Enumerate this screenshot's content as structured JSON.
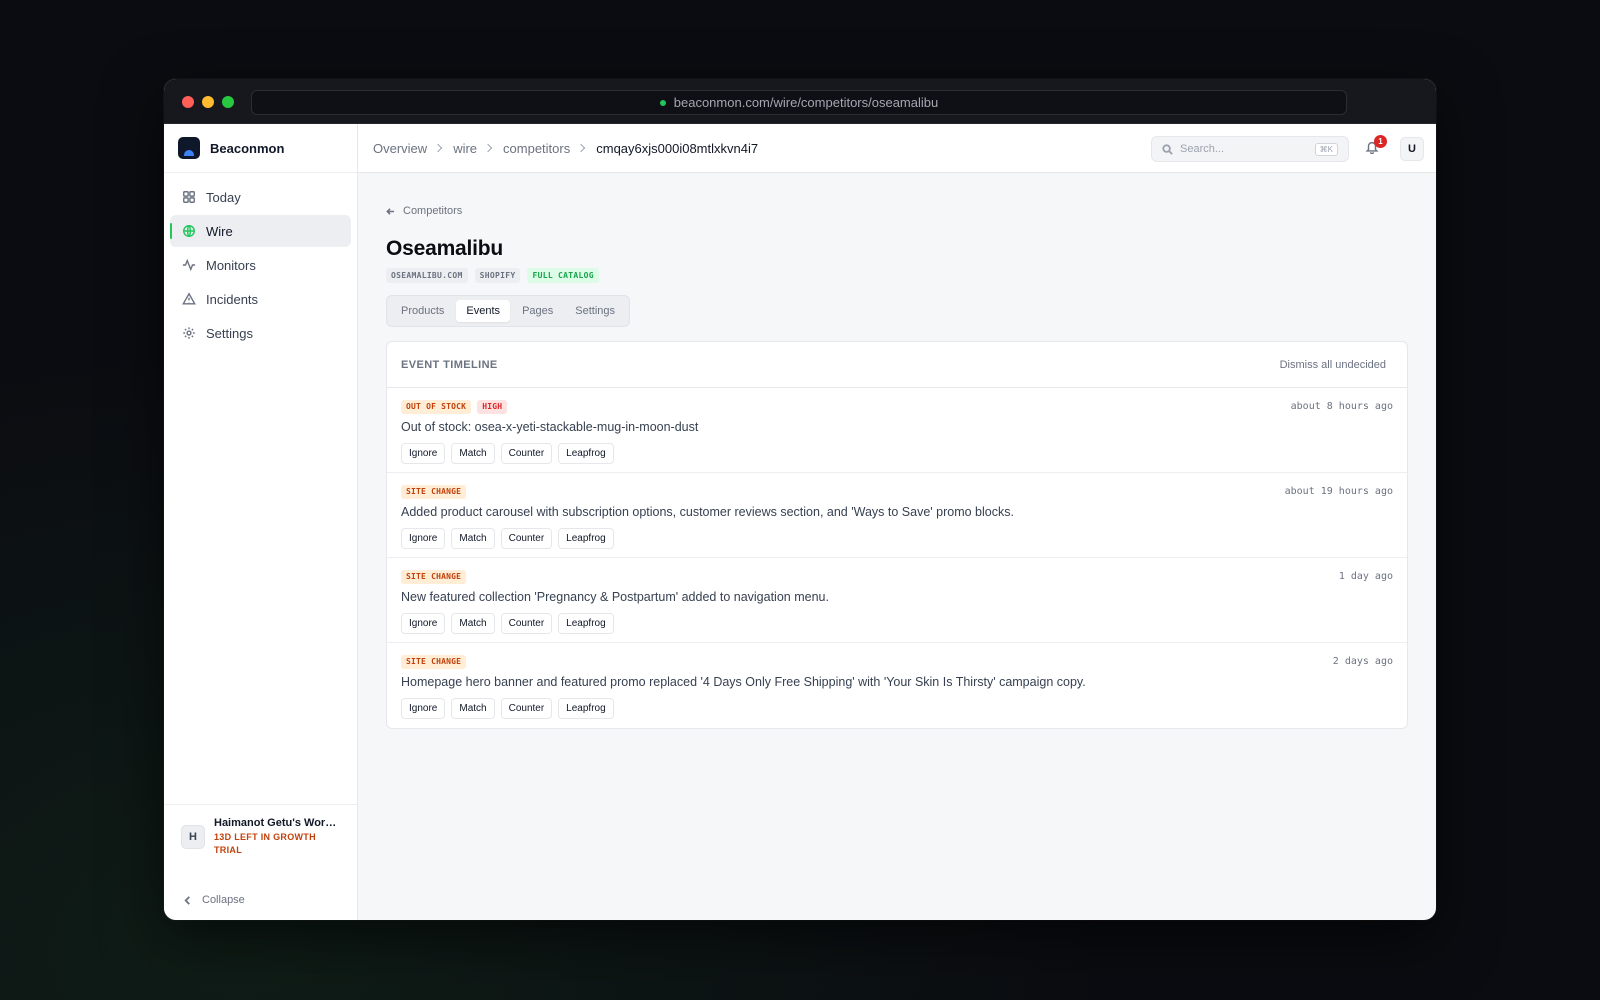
{
  "browser": {
    "url": "beaconmon.com/wire/competitors/oseamalibu"
  },
  "brand": {
    "name": "Beaconmon"
  },
  "sidebar": {
    "items": [
      {
        "label": "Today",
        "icon": "grid-icon"
      },
      {
        "label": "Wire",
        "icon": "globe-icon",
        "active": true
      },
      {
        "label": "Monitors",
        "icon": "activity-icon"
      },
      {
        "label": "Incidents",
        "icon": "alert-triangle-icon"
      },
      {
        "label": "Settings",
        "icon": "gear-icon"
      }
    ],
    "workspace": {
      "initial": "H",
      "name": "Haimanot Getu's Work...",
      "trial": "13D LEFT IN GROWTH TRIAL"
    },
    "collapse_label": "Collapse"
  },
  "header": {
    "breadcrumbs": [
      "Overview",
      "wire",
      "competitors",
      "cmqay6xjs000i08mtlxkvn4i7"
    ],
    "search_placeholder": "Search...",
    "search_shortcut": "⌘K",
    "notification_count": "1",
    "user_initial": "U"
  },
  "page": {
    "back_label": "Competitors",
    "title": "Oseamalibu",
    "tags": [
      {
        "label": "OSEAMALIBU.COM",
        "style": "gray"
      },
      {
        "label": "SHOPIFY",
        "style": "gray"
      },
      {
        "label": "FULL CATALOG",
        "style": "green"
      }
    ],
    "tabs": [
      "Products",
      "Events",
      "Pages",
      "Settings"
    ],
    "active_tab": "Events"
  },
  "timeline": {
    "title": "EVENT TIMELINE",
    "dismiss_label": "Dismiss all undecided",
    "actions": [
      "Ignore",
      "Match",
      "Counter",
      "Leapfrog"
    ],
    "events": [
      {
        "tags": [
          {
            "label": "OUT OF STOCK",
            "color": "#c2410c"
          },
          {
            "label": "HIGH",
            "color": "#dc2626"
          }
        ],
        "time": "about 8 hours ago",
        "description": "Out of stock: osea-x-yeti-stackable-mug-in-moon-dust"
      },
      {
        "tags": [
          {
            "label": "SITE CHANGE",
            "color": "#c2410c"
          }
        ],
        "time": "about 19 hours ago",
        "description": "Added product carousel with subscription options, customer reviews section, and 'Ways to Save' promo blocks."
      },
      {
        "tags": [
          {
            "label": "SITE CHANGE",
            "color": "#c2410c"
          }
        ],
        "time": "1 day ago",
        "description": "New featured collection 'Pregnancy & Postpartum' added to navigation menu."
      },
      {
        "tags": [
          {
            "label": "SITE CHANGE",
            "color": "#c2410c"
          }
        ],
        "time": "2 days ago",
        "description": "Homepage hero banner and featured promo replaced '4 Days Only Free Shipping' with 'Your Skin Is Thirsty' campaign copy."
      }
    ]
  }
}
